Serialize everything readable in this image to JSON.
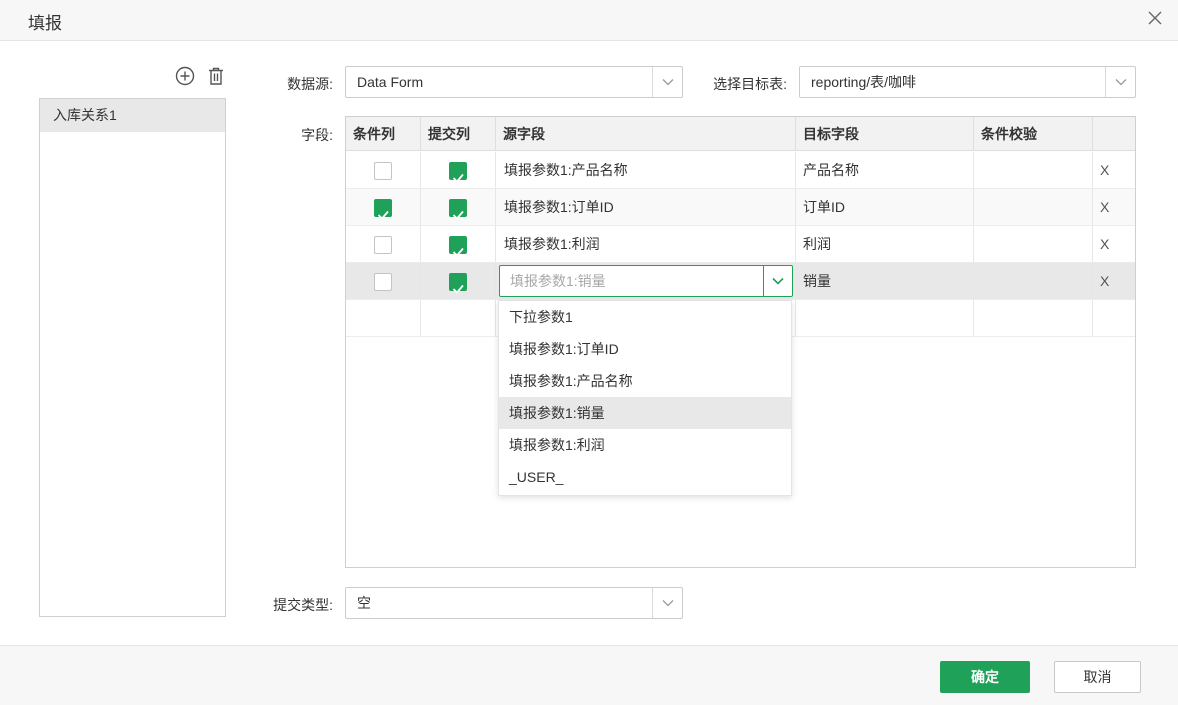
{
  "dialog": {
    "title": "填报"
  },
  "relations": {
    "items": [
      "入库关系1"
    ]
  },
  "datasource": {
    "label": "数据源:",
    "value": "Data Form"
  },
  "target": {
    "label": "选择目标表:",
    "value": "reporting/表/咖啡"
  },
  "fields": {
    "label": "字段:",
    "headers": [
      "条件列",
      "提交列",
      "源字段",
      "目标字段",
      "条件校验"
    ],
    "rows": [
      {
        "condition": false,
        "submit": true,
        "source": "填报参数1:产品名称",
        "target": "产品名称",
        "delete": "X"
      },
      {
        "condition": true,
        "submit": true,
        "source": "填报参数1:订单ID",
        "target": "订单ID",
        "delete": "X"
      },
      {
        "condition": false,
        "submit": true,
        "source": "填报参数1:利润",
        "target": "利润",
        "delete": "X"
      },
      {
        "condition": false,
        "submit": true,
        "source_placeholder": "填报参数1:销量",
        "target": "销量",
        "delete": "X"
      }
    ]
  },
  "dropdown": {
    "options": [
      "下拉参数1",
      "填报参数1:订单ID",
      "填报参数1:产品名称",
      "填报参数1:销量",
      "填报参数1:利润",
      "_USER_"
    ],
    "selected": "填报参数1:销量"
  },
  "submit_type": {
    "label": "提交类型:",
    "value": "空"
  },
  "buttons": {
    "ok": "确定",
    "cancel": "取消"
  },
  "colors": {
    "accent": "#1fa15a",
    "selected_row": "#e8e8e8",
    "header_bg": "#f7f7f7"
  }
}
